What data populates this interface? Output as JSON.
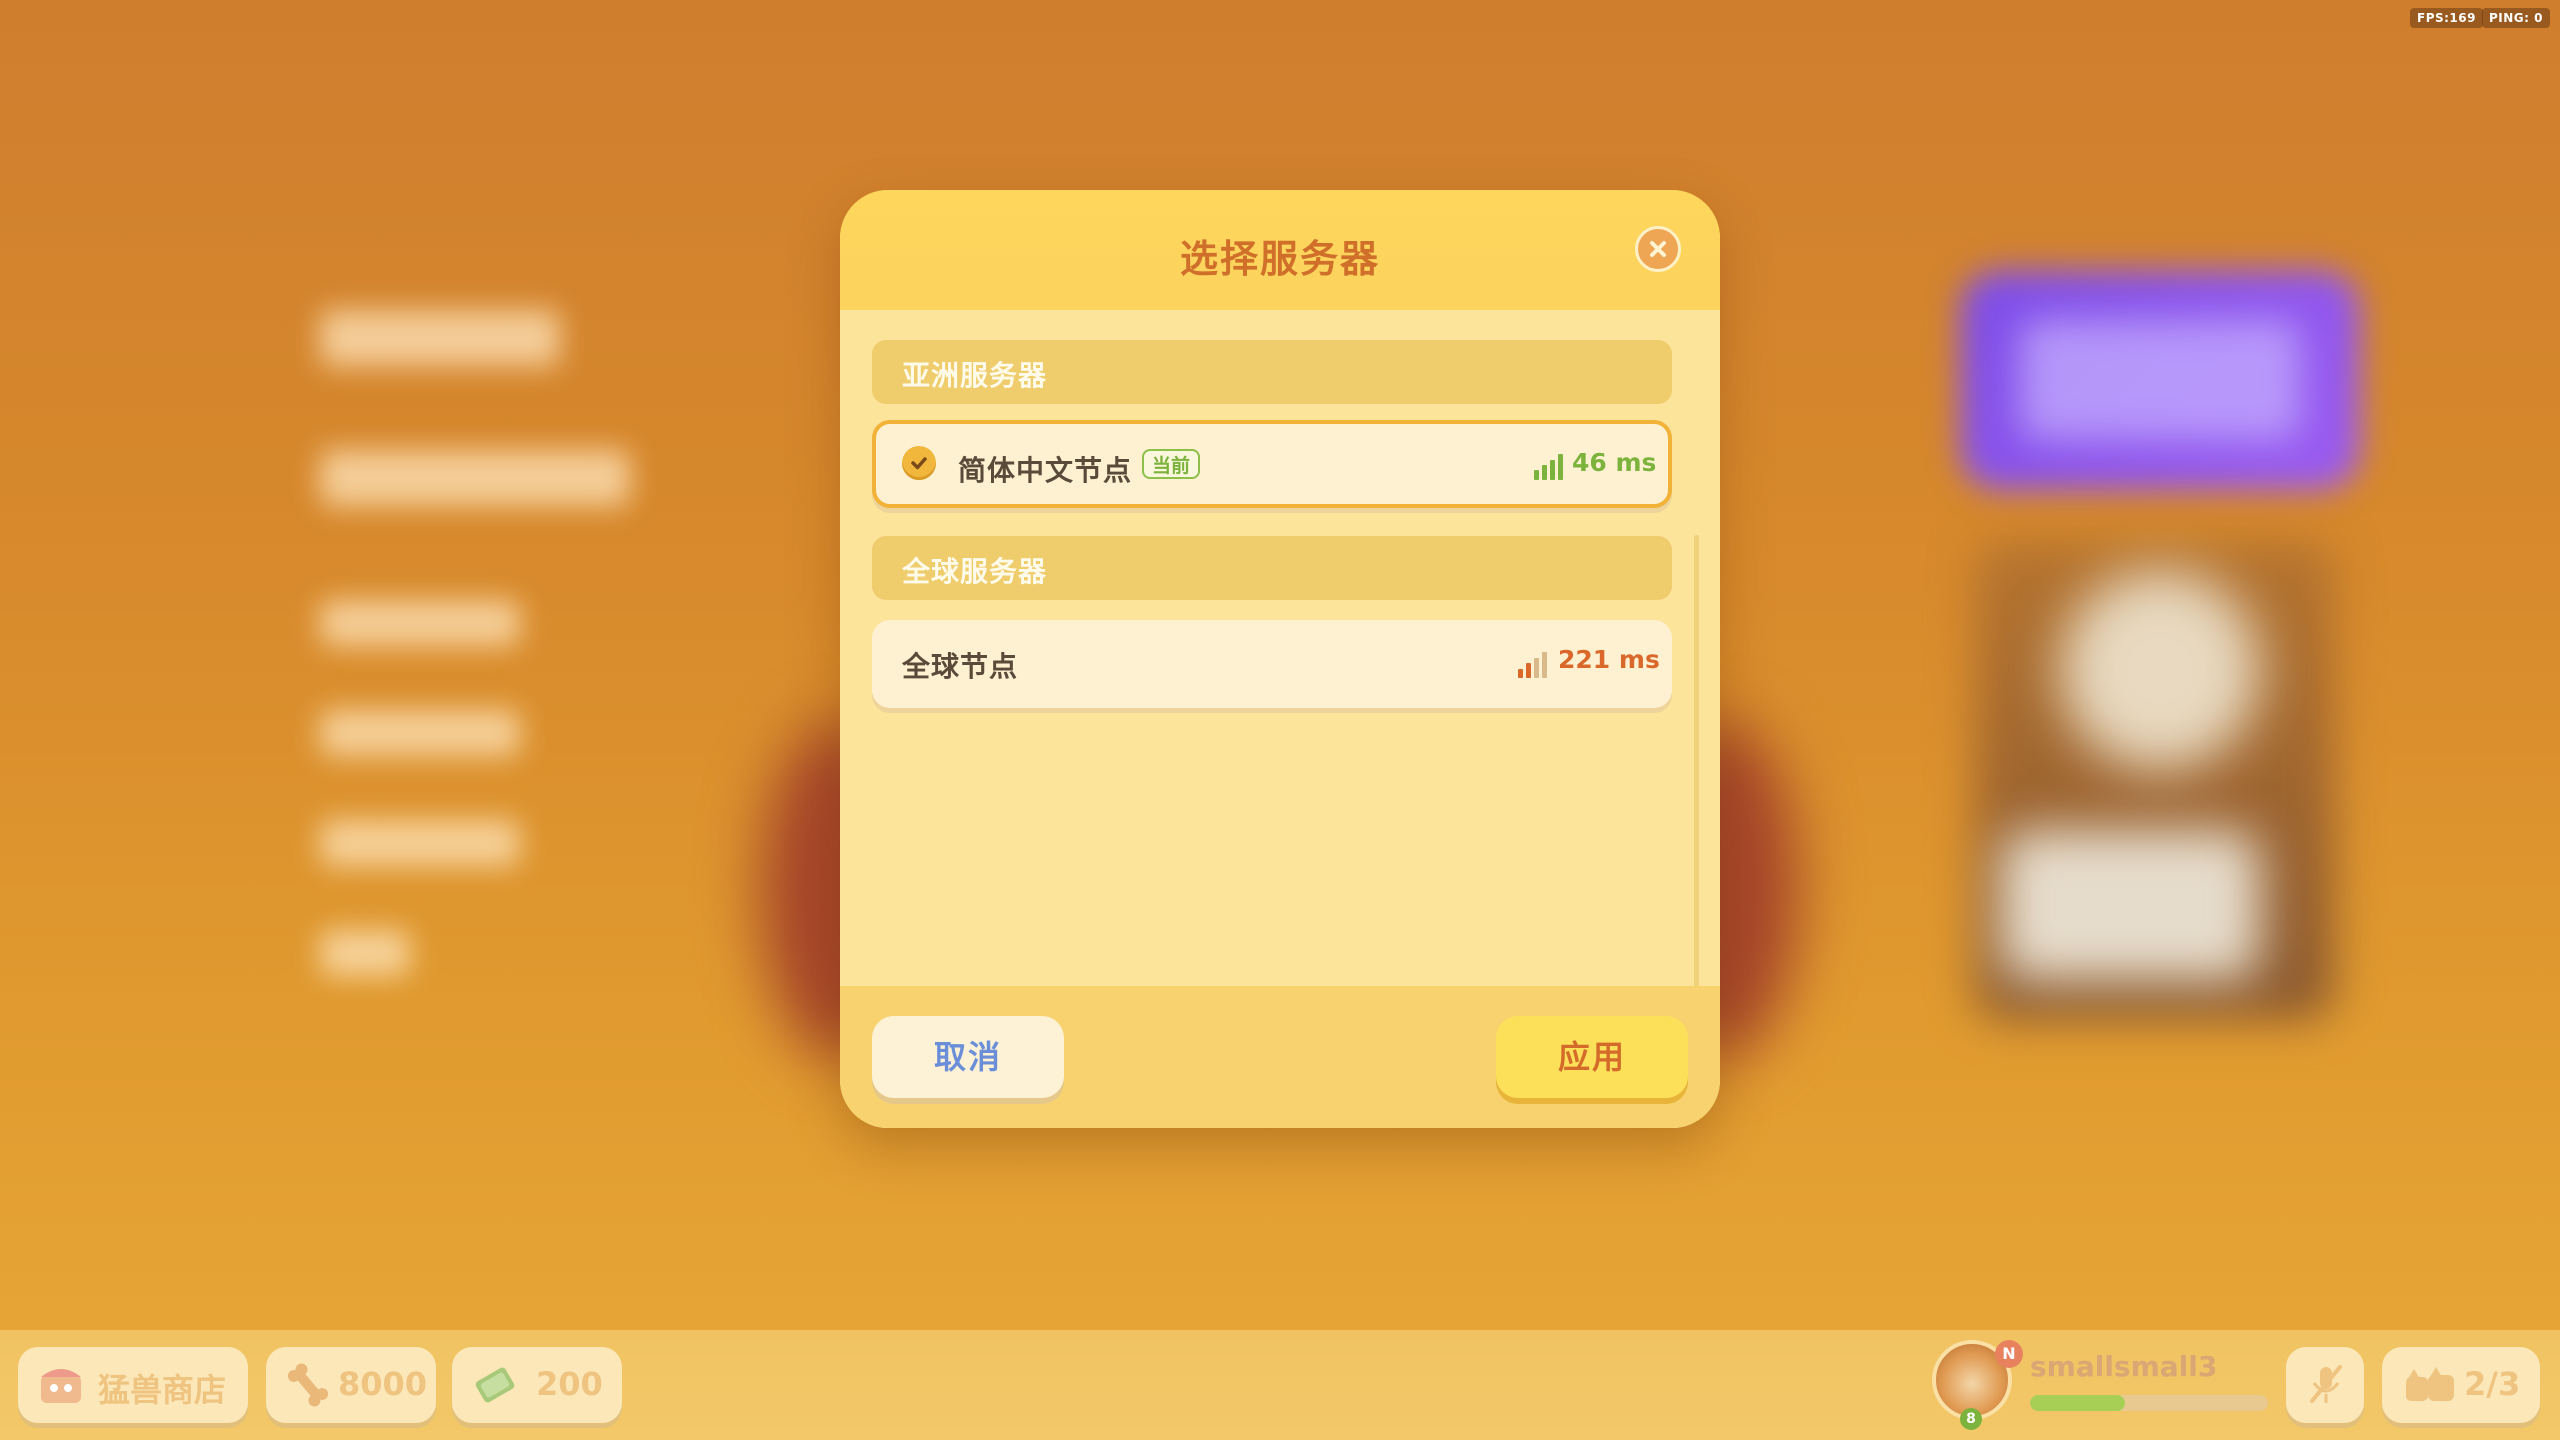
{
  "hud": {
    "fps": "FPS:169",
    "ping": "PING: 0"
  },
  "dialog": {
    "title": "选择服务器",
    "sections": [
      {
        "label": "亚洲服务器",
        "servers": [
          {
            "name": "简体中文节点",
            "badge": "当前",
            "latency": "46 ms",
            "selected": true,
            "signal_bars": 4,
            "signal_color": "#7cb33c"
          }
        ]
      },
      {
        "label": "全球服务器",
        "servers": [
          {
            "name": "全球节点",
            "latency": "221 ms",
            "selected": false,
            "signal_bars": 2,
            "signal_color": "#d9682a"
          }
        ]
      }
    ],
    "cancel_label": "取消",
    "apply_label": "应用"
  },
  "bottom_bar": {
    "shop_label": "猛兽商店",
    "bones": "8000",
    "cash": "200",
    "player": {
      "name": "smallsmall3",
      "badge": "N",
      "level": "8",
      "xp_fraction": 0.4
    },
    "party": "2/3"
  }
}
